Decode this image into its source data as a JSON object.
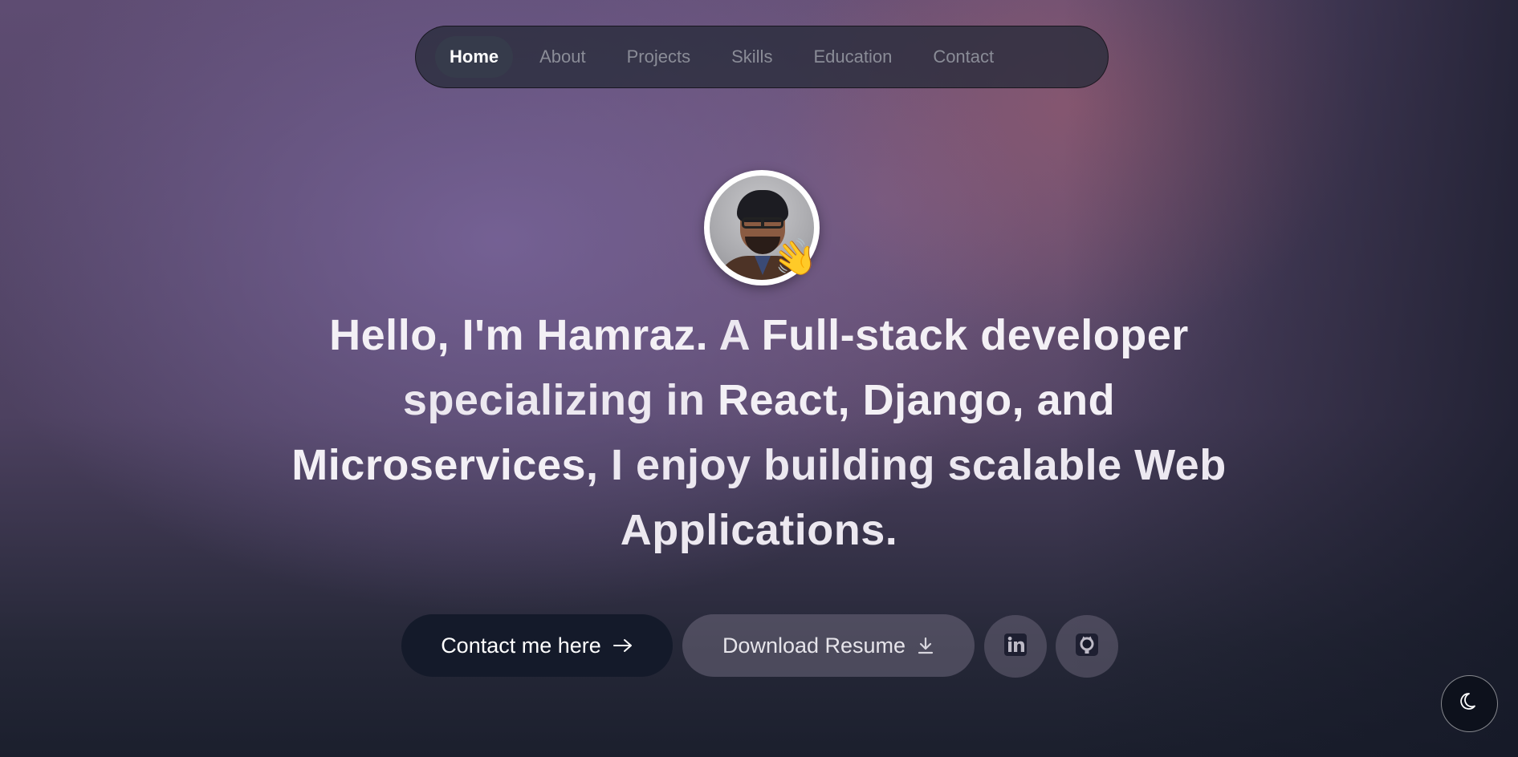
{
  "nav": {
    "items": [
      {
        "label": "Home",
        "active": true
      },
      {
        "label": "About",
        "active": false
      },
      {
        "label": "Projects",
        "active": false
      },
      {
        "label": "Skills",
        "active": false
      },
      {
        "label": "Education",
        "active": false
      },
      {
        "label": "Contact",
        "active": false
      }
    ]
  },
  "hero": {
    "avatar_badge_icon": "waving-hand-icon",
    "wave_emoji": "👋",
    "headline": {
      "part1_bold": "Hello, I'm Hamraz.",
      "part2": " A ",
      "part3_bold": "Full-stack developer",
      "part4": " specializing in ",
      "part5_bold": "React, Django, and Microservices",
      "part6": ", I enjoy building scalable Web Applications."
    }
  },
  "actions": {
    "contact_label": "Contact me here",
    "contact_icon": "arrow-right-icon",
    "resume_label": "Download Resume",
    "resume_icon": "download-icon",
    "linkedin_icon": "linkedin-icon",
    "github_icon": "github-icon"
  },
  "theme_toggle": {
    "icon": "moon-icon"
  },
  "colors": {
    "contact_button_bg": "#141a2a",
    "nav_active_bg": "#363b4b",
    "text_primary": "#ece8f0"
  }
}
